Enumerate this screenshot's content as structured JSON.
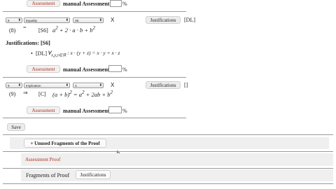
{
  "top": {
    "assessment_button": "Assessment",
    "manual_label": "manual Assessment",
    "percent": "%"
  },
  "step8": {
    "number_select": "8",
    "type_select": "Equality",
    "ref_select": "S6",
    "delete_x": "X",
    "justifications_button": "Justifications",
    "justification_tag": "[DL]",
    "line_number": "(8)",
    "relation": "=",
    "ref": "[S6]",
    "formula_html": "a<sup>2</sup> + 2 · a · b + b<sup>2</sup>"
  },
  "justifications_block": {
    "heading": "Justifications: [S6]",
    "bullet": "•",
    "tag": "[DL]",
    "formula_html": "∀<sub>x,y,z∈ℝ</sub> : x · (y + z) = x · y + x · z"
  },
  "assess8": {
    "assessment_button": "Assessment",
    "manual_label": "manual Assessment",
    "percent": "%"
  },
  "step9": {
    "number_select": "9",
    "type_select": "Implication",
    "ref_select": "C",
    "delete_x": "X",
    "justifications_button": "Justifications",
    "justification_tag": "[]",
    "line_number": "(9)",
    "relation": "⇒",
    "ref": "[C]",
    "formula_html": "(a + b)<sup>2</sup> = a<sup>2</sup> + 2ab + b<sup>2</sup>"
  },
  "assess9": {
    "assessment_button": "Assessment",
    "manual_label": "manual Assessment",
    "percent": "%"
  },
  "save_button": "Save",
  "unused_fragments_button": "+ Unused Fragments of the Proof",
  "assessment_proof_tab": "Assessment Proof",
  "bottom_tabs": {
    "fragments": "Fragments of Proof",
    "justifications": "Justifications"
  },
  "colors": {
    "assessment_red": "#b0301a",
    "panel_gray": "#efefef",
    "rule_gray": "#9a9a9a"
  }
}
